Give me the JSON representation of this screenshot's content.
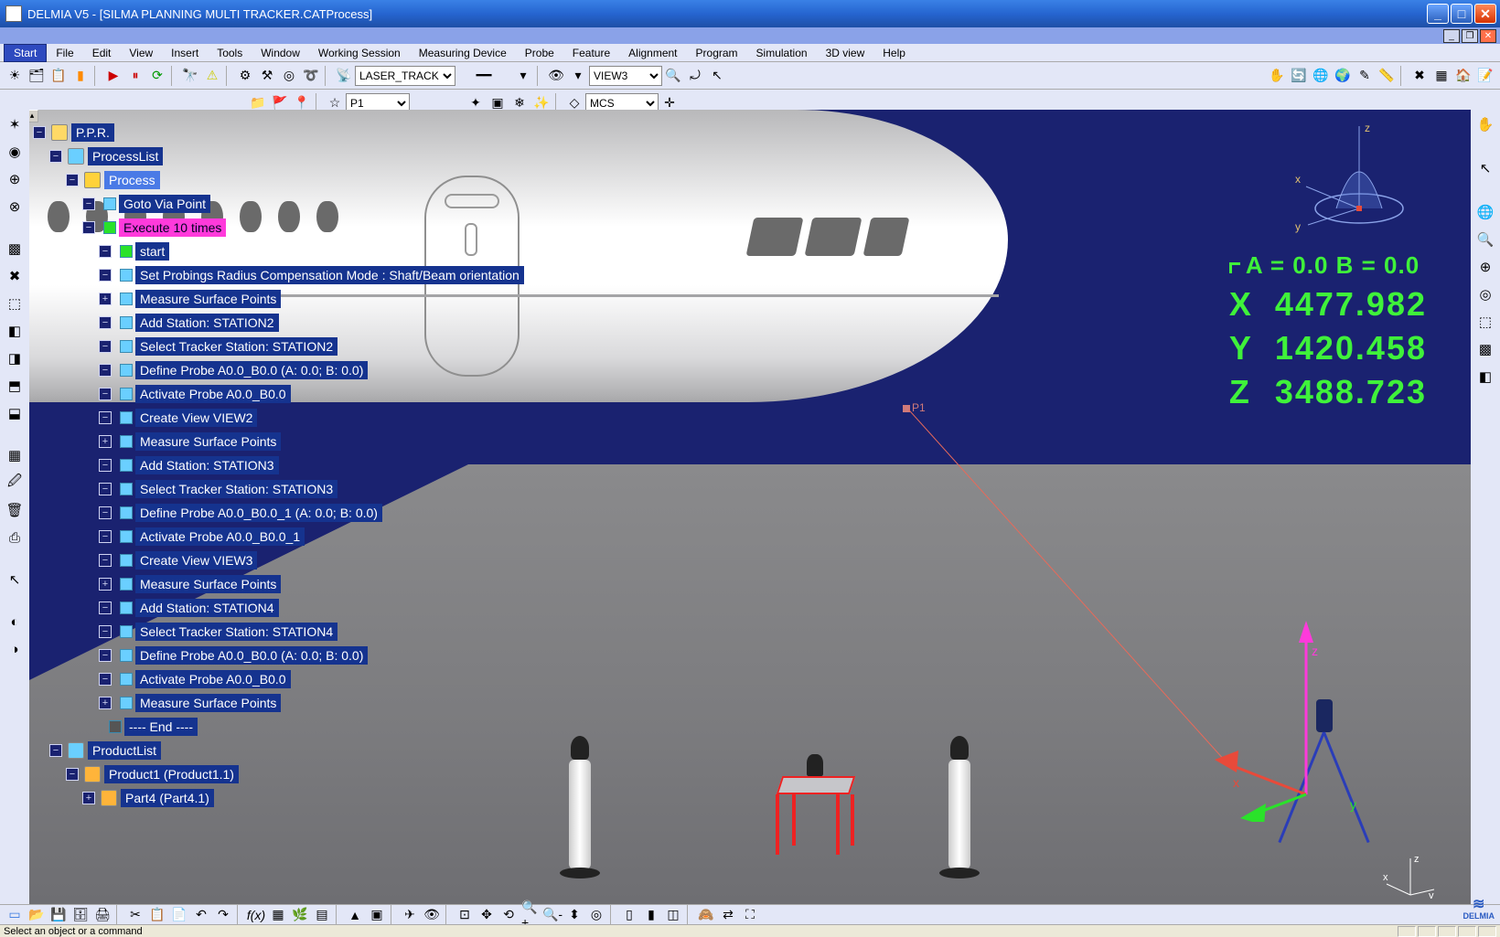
{
  "window": {
    "title": "DELMIA V5 - [SILMA PLANNING MULTI TRACKER.CATProcess]"
  },
  "menu": {
    "items": [
      "Start",
      "File",
      "Edit",
      "View",
      "Insert",
      "Tools",
      "Window",
      "Working Session",
      "Measuring Device",
      "Probe",
      "Feature",
      "Alignment",
      "Program",
      "Simulation",
      "3D view",
      "Help"
    ],
    "selected": 0
  },
  "toolbar1": {
    "tracker_combo": "LASER_TRACK",
    "view_combo": "VIEW3"
  },
  "toolbar2": {
    "point_combo": "P1",
    "coord_combo": "MCS"
  },
  "tree": {
    "root": "P.P.R.",
    "processList": "ProcessList",
    "process": "Process",
    "items": [
      "Goto Via Point",
      "Execute 10 times",
      "start",
      "Set Probings Radius Compensation Mode : Shaft/Beam orientation",
      "Measure Surface Points",
      "Add Station: STATION2",
      "Select Tracker Station: STATION2",
      "Define Probe A0.0_B0.0 (A:  0.0; B:  0.0)",
      "Activate Probe A0.0_B0.0",
      "Create View VIEW2",
      "Measure Surface Points",
      "Add Station: STATION3",
      "Select Tracker Station: STATION3",
      "Define Probe A0.0_B0.0_1 (A:  0.0; B:  0.0)",
      "Activate Probe A0.0_B0.0_1",
      "Create View VIEW3",
      "Measure Surface Points",
      "Add Station: STATION4",
      "Select Tracker Station: STATION4",
      "Define Probe A0.0_B0.0 (A:  0.0; B:  0.0)",
      "Activate Probe A0.0_B0.0",
      "Measure Surface Points",
      "---- End ----"
    ],
    "productList": "ProductList",
    "product1": "Product1 (Product1.1)",
    "part4": "Part4 (Part4.1)"
  },
  "viewport": {
    "point_label": "P1",
    "compass": {
      "x": "x",
      "y": "y",
      "z": "z"
    }
  },
  "coords": {
    "ab": "A =  0.0     B =  0.0",
    "x_lbl": "X",
    "x_val": "4477.982",
    "y_lbl": "Y",
    "y_val": "1420.458",
    "z_lbl": "Z",
    "z_val": "3488.723"
  },
  "status": {
    "text": "Select an object or a command"
  },
  "brand": "DELMIA"
}
